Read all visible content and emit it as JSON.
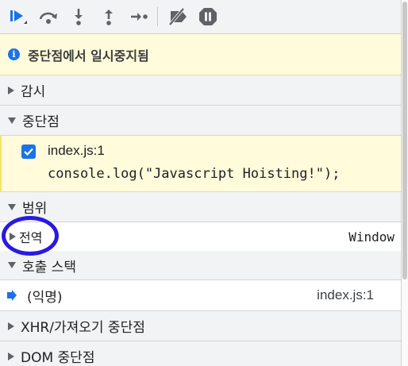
{
  "toolbar": {
    "buttons": [
      {
        "name": "resume-icon"
      },
      {
        "name": "step-over-icon"
      },
      {
        "name": "step-into-icon"
      },
      {
        "name": "step-out-icon"
      },
      {
        "name": "step-icon"
      },
      {
        "name": "deactivate-breakpoints-icon"
      },
      {
        "name": "pause-on-exceptions-icon"
      }
    ]
  },
  "banner": {
    "text": "중단점에서 일시중지됨"
  },
  "sections": {
    "watch": "감시",
    "breakpoints": "중단점",
    "scope": "범위",
    "callstack": "호출 스택",
    "xhr": "XHR/가져오기 중단점",
    "dom": "DOM 중단점"
  },
  "breakpoint": {
    "file": "index.js:1",
    "code": "console.log(\"Javascript Hoisting!\");",
    "checked": true
  },
  "scope": {
    "name": "전역",
    "value": "Window"
  },
  "callstack": {
    "frame_name": "(익명)",
    "frame_location": "index.js:1"
  },
  "colors": {
    "accent": "#1a73e8",
    "banner_bg": "#fffbdb",
    "annotation": "#2a1ae0"
  }
}
